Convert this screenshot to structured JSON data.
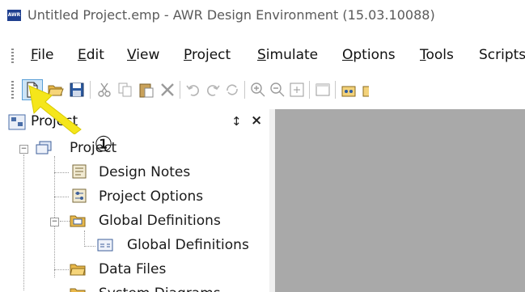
{
  "window": {
    "logo_text": "AWR",
    "title": "Untitled Project.emp - AWR Design Environment (15.03.10088)"
  },
  "menu": {
    "items": [
      {
        "label": "File",
        "accel": "F",
        "rest": "ile"
      },
      {
        "label": "Edit",
        "accel": "E",
        "rest": "dit"
      },
      {
        "label": "View",
        "accel": "V",
        "rest": "iew"
      },
      {
        "label": "Project",
        "accel": "P",
        "rest": "roject"
      },
      {
        "label": "Simulate",
        "accel": "S",
        "rest": "imulate"
      },
      {
        "label": "Options",
        "accel": "O",
        "rest": "ptions"
      },
      {
        "label": "Tools",
        "accel": "T",
        "rest": "ools"
      },
      {
        "label": "Scripts",
        "accel": "",
        "rest": "Scripts"
      }
    ]
  },
  "toolbar": {
    "buttons": [
      "new-file-icon",
      "open-folder-icon",
      "save-icon",
      "cut-icon",
      "copy-icon",
      "paste-icon",
      "delete-icon",
      "undo-icon",
      "redo-icon",
      "refresh-icon",
      "zoom-in-icon",
      "zoom-out-icon",
      "zoom-fit-icon",
      "window-icon",
      "schematic-icon"
    ]
  },
  "panel": {
    "title": "Project",
    "pin_glyph": "↕",
    "close_glyph": "×"
  },
  "tree": {
    "items": [
      {
        "label": "Project",
        "icon": "project-icon"
      },
      {
        "label": "Design Notes",
        "icon": "notes-icon"
      },
      {
        "label": "Project Options",
        "icon": "options-icon"
      },
      {
        "label": "Global Definitions",
        "icon": "global-defs-icon"
      },
      {
        "label": "Global Definitions",
        "icon": "global-def-doc-icon"
      },
      {
        "label": "Data Files",
        "icon": "folder-icon"
      },
      {
        "label": "System Diagrams",
        "icon": "system-diagram-icon"
      }
    ]
  },
  "callout": {
    "number": "①",
    "color": "#f5e61a"
  }
}
